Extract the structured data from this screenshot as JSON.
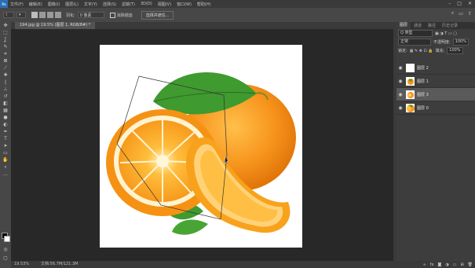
{
  "menu": {
    "logo": "Ps",
    "items": [
      "文件(F)",
      "编辑(E)",
      "图像(I)",
      "图层(L)",
      "文字(Y)",
      "选择(S)",
      "滤镜(T)",
      "3D(D)",
      "视图(V)",
      "窗口(W)",
      "帮助(H)"
    ]
  },
  "options": {
    "feather_label": "羽化:",
    "feather_value": "0 像素",
    "antialias_label": "消除锯齿",
    "select_button": "选择并遮住..."
  },
  "document_tab": "194.jpg @ 19.5% (图层 1, RGB/8#) *",
  "status": {
    "zoom": "19.53%",
    "doc_info": "文档:56.7M/121.3M"
  },
  "panel": {
    "tabs": [
      "图层",
      "通道",
      "路径",
      "历史记录"
    ],
    "kind_label": "Q 类型",
    "blend_mode": "正常",
    "opacity_label": "不透明度:",
    "opacity_value": "100%",
    "lock_label": "锁定:",
    "fill_label": "填充:",
    "fill_value": "100%",
    "layers": [
      {
        "name": "图层 2",
        "thumb": "white"
      },
      {
        "name": "图层 1",
        "thumb": "orange-slice"
      },
      {
        "name": "图层 3",
        "thumb": "orange-slice"
      },
      {
        "name": "图层 0",
        "thumb": "orange-full"
      }
    ],
    "selected_index": 2
  },
  "colors": {
    "orange": "#f7941d",
    "leaf": "#3f9a2f",
    "selected_layer": "#5a5a5a"
  }
}
